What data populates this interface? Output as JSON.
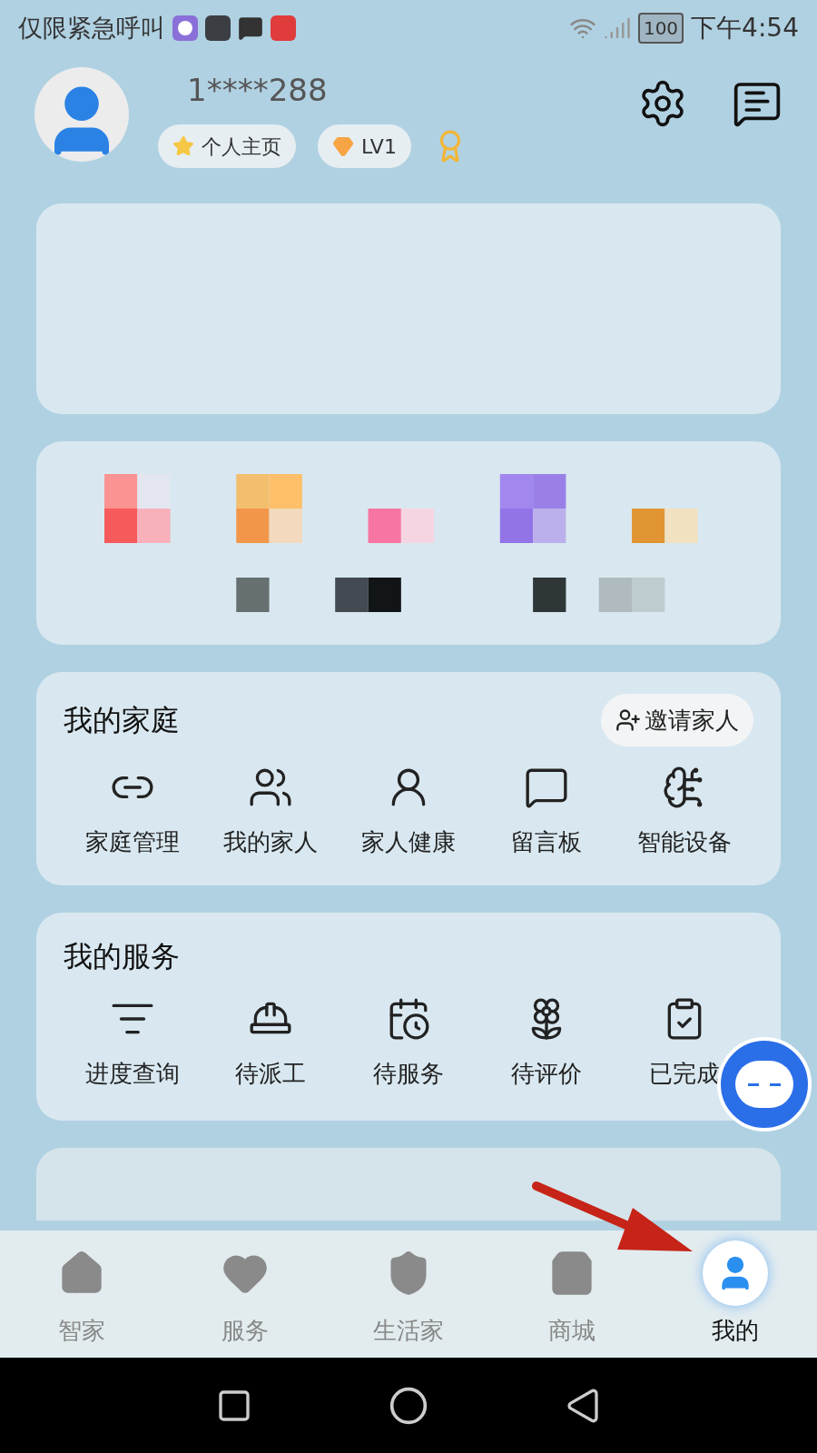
{
  "status_bar": {
    "carrier_text": "仅限紧急呼叫",
    "battery": "100",
    "time": "下午4:54"
  },
  "profile": {
    "username": "1****288",
    "badges": [
      {
        "label": "个人主页"
      },
      {
        "label": "LV1"
      }
    ]
  },
  "family": {
    "title": "我的家庭",
    "invite_button": "邀请家人",
    "items": [
      {
        "label": "家庭管理"
      },
      {
        "label": "我的家人"
      },
      {
        "label": "家人健康"
      },
      {
        "label": "留言板"
      },
      {
        "label": "智能设备"
      }
    ]
  },
  "services": {
    "title": "我的服务",
    "items": [
      {
        "label": "进度查询"
      },
      {
        "label": "待派工"
      },
      {
        "label": "待服务"
      },
      {
        "label": "待评价"
      },
      {
        "label": "已完成"
      }
    ]
  },
  "tab_bar": [
    {
      "label": "智家",
      "selected": false
    },
    {
      "label": "服务",
      "selected": false
    },
    {
      "label": "生活家",
      "selected": false
    },
    {
      "label": "商城",
      "selected": false
    },
    {
      "label": "我的",
      "selected": true
    }
  ]
}
